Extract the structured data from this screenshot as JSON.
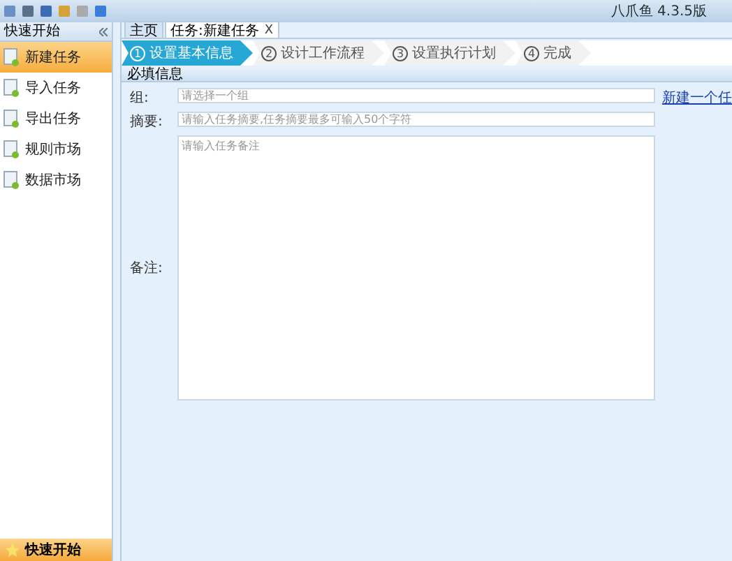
{
  "window": {
    "title": "八爪鱼 4.3.5版"
  },
  "sidebar": {
    "title": "快速开始",
    "items": [
      {
        "label": "新建任务",
        "selected": true
      },
      {
        "label": "导入任务",
        "selected": false
      },
      {
        "label": "导出任务",
        "selected": false
      },
      {
        "label": "规则市场",
        "selected": false
      },
      {
        "label": "数据市场",
        "selected": false
      }
    ],
    "footer": "快速开始"
  },
  "tabs": [
    {
      "label": "主页",
      "selected": false
    },
    {
      "label": "任务:新建任务",
      "selected": true,
      "close": "X"
    }
  ],
  "steps": [
    {
      "number": "1",
      "label": "设置基本信息",
      "selected": true
    },
    {
      "number": "2",
      "label": "设计工作流程",
      "selected": false
    },
    {
      "number": "3",
      "label": "设置执行计划",
      "selected": false
    },
    {
      "number": "4",
      "label": "完成",
      "selected": false
    }
  ],
  "section": {
    "title": "必填信息"
  },
  "form": {
    "group": {
      "label": "组:",
      "placeholder": "请选择一个组"
    },
    "summary": {
      "label": "摘要:",
      "placeholder": "请输入任务摘要,任务摘要最多可输入50个字符"
    },
    "notes": {
      "label": "备注:",
      "placeholder": "请输入任务备注"
    },
    "link": "新建一个任"
  }
}
